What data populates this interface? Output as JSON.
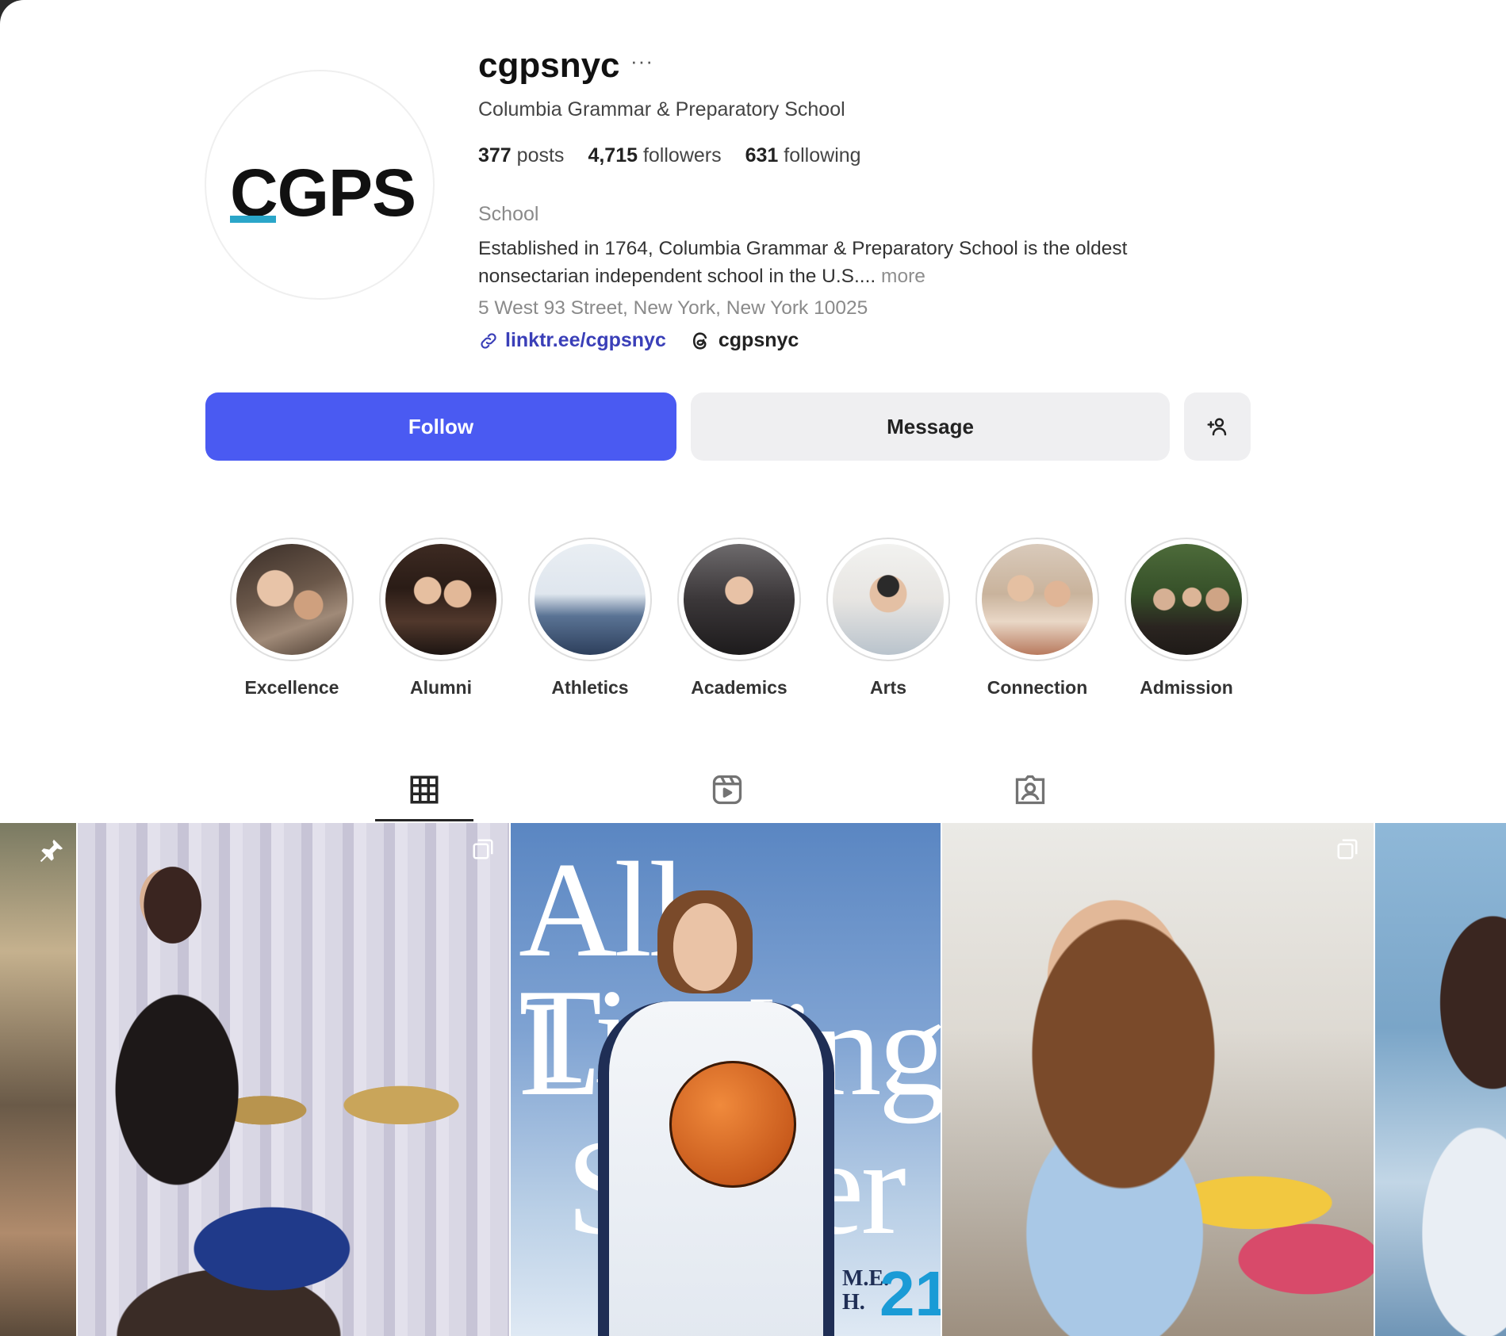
{
  "profile": {
    "avatar_text": "CGPS",
    "username": "cgpsnyc",
    "more_glyph": "···",
    "full_name": "Columbia Grammar & Preparatory School",
    "stats": {
      "posts_count": "377",
      "posts_label": "posts",
      "followers_count": "4,715",
      "followers_label": "followers",
      "following_count": "631",
      "following_label": "following"
    },
    "category": "School",
    "bio": "Established in 1764, Columbia Grammar & Preparatory School is the oldest nonsectarian independent school in the U.S....",
    "bio_more": "more",
    "address": "5 West 93 Street, New York, New York 10025",
    "link_url": "linktr.ee/cgpsnyc",
    "threads_handle": "cgpsnyc",
    "accent_color": "#2aa6c9"
  },
  "actions": {
    "follow_label": "Follow",
    "message_label": "Message",
    "suggest_icon": "add-person-icon",
    "follow_color": "#4a5af2"
  },
  "highlights": [
    {
      "label": "Excellence"
    },
    {
      "label": "Alumni"
    },
    {
      "label": "Athletics"
    },
    {
      "label": "Academics"
    },
    {
      "label": "Arts"
    },
    {
      "label": "Connection"
    },
    {
      "label": "Admission"
    }
  ],
  "tabs": [
    {
      "name": "posts",
      "icon": "grid-icon",
      "active": true
    },
    {
      "name": "reels",
      "icon": "reels-icon",
      "active": false
    },
    {
      "name": "tagged",
      "icon": "tagged-icon",
      "active": false
    }
  ],
  "posts": {
    "cover_text": {
      "line1": "All Time",
      "line2": "Leading",
      "line3": "Scorer",
      "initials": "M.E. H.",
      "number": "21"
    }
  }
}
